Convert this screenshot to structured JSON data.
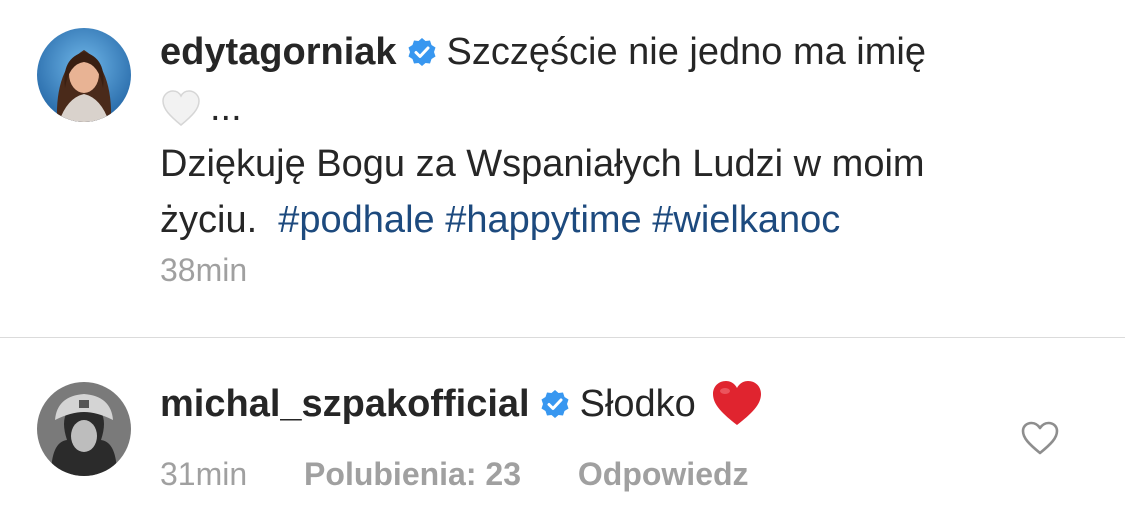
{
  "comments": [
    {
      "username": "edytagorniak",
      "verified": true,
      "text_line1": "Szczęście nie jedno ma imię",
      "text_after_heart": "...",
      "text_line3": "Dziękuję Bogu za Wspaniałych Ludzi w moim",
      "text_line4_prefix": "życiu.",
      "hashtags": [
        "#podhale",
        "#happytime",
        "#wielkanoc"
      ],
      "time": "38min",
      "emoji": "white-heart"
    },
    {
      "username": "michal_szpakofficial",
      "verified": true,
      "text": "Słodko",
      "emoji": "red-heart",
      "time": "31min",
      "likes_label": "Polubienia: 23",
      "reply_label": "Odpowiedz"
    }
  ],
  "colors": {
    "text": "#262626",
    "meta": "#a0a0a0",
    "hashtag": "#1d4a7e",
    "verified": "#3897f0",
    "divider": "#dbdbdb",
    "heart_red": "#e0242f"
  }
}
